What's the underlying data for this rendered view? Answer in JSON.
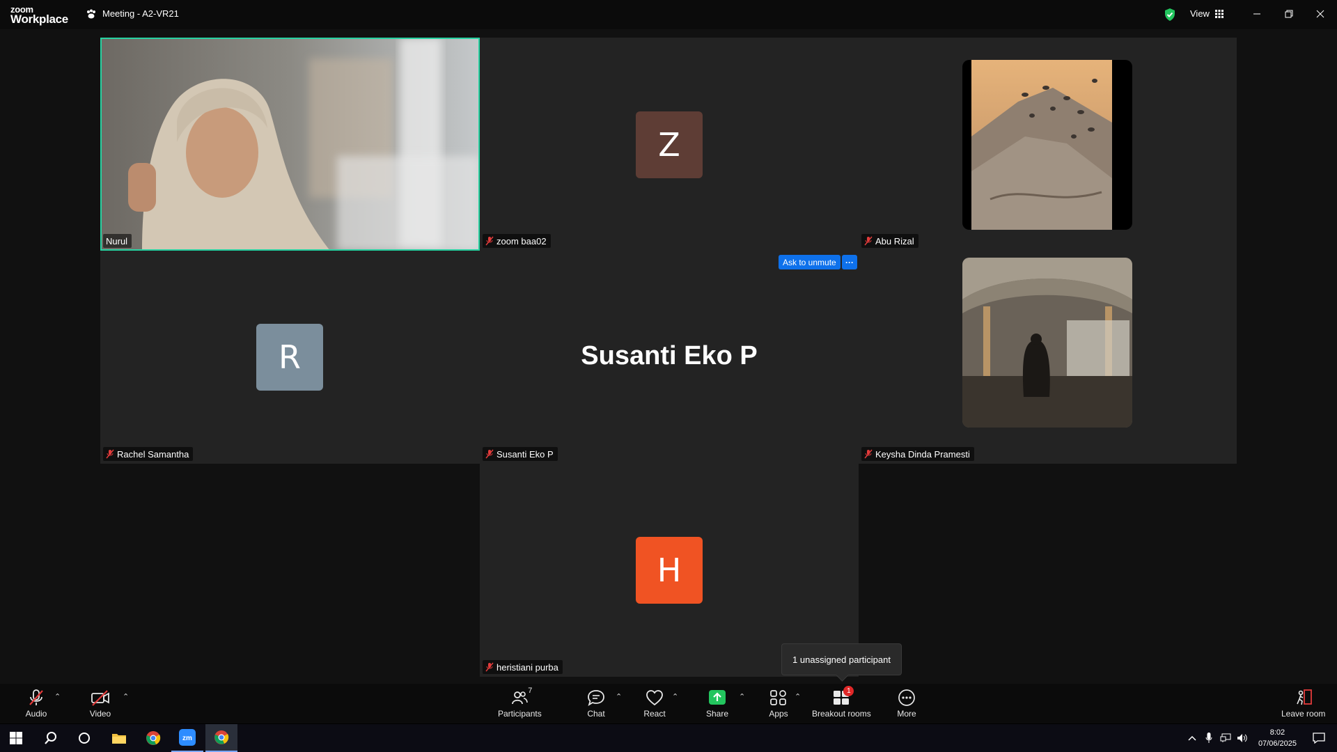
{
  "app": {
    "logo_line1": "zoom",
    "logo_line2": "Workplace",
    "meeting_title": "Meeting - A2-VR21",
    "view_label": "View"
  },
  "participants": [
    {
      "id": "nurul",
      "name": "Nurul",
      "type": "video",
      "active_speaker": true,
      "muted": false
    },
    {
      "id": "zoom-baa02",
      "name": "zoom baa02",
      "type": "avatar",
      "initial": "Z",
      "color": "#5e3d35",
      "muted": true
    },
    {
      "id": "abu-rizal",
      "name": "Abu Rizal",
      "type": "photo",
      "muted": true
    },
    {
      "id": "rachel",
      "name": "Rachel Samantha",
      "type": "avatar",
      "initial": "R",
      "color": "#7b8e9c",
      "muted": true
    },
    {
      "id": "susanti",
      "name": "Susanti Eko P",
      "type": "name-only",
      "display_name": "Susanti Eko P",
      "muted": true
    },
    {
      "id": "keysha",
      "name": "Keysha Dinda Pramesti",
      "type": "photo",
      "muted": true
    },
    {
      "id": "heristiani",
      "name": "heristiani purba",
      "type": "avatar",
      "initial": "H",
      "color": "#f05323",
      "muted": true
    }
  ],
  "hover_actions": {
    "ask_unmute": "Ask to unmute",
    "more": "···"
  },
  "tooltip": "1 unassigned participant",
  "toolbar": {
    "audio": "Audio",
    "video": "Video",
    "participants": "Participants",
    "participants_count": "7",
    "chat": "Chat",
    "react": "React",
    "share": "Share",
    "apps": "Apps",
    "breakout": "Breakout rooms",
    "breakout_badge": "1",
    "more": "More",
    "leave": "Leave room"
  },
  "taskbar": {
    "time": "8:02",
    "date": "07/06/2025"
  },
  "colors": {
    "active_border": "#27d3a2",
    "accent_blue": "#0e71eb",
    "share_green": "#23c55e",
    "mute_red": "#e23b3b"
  }
}
